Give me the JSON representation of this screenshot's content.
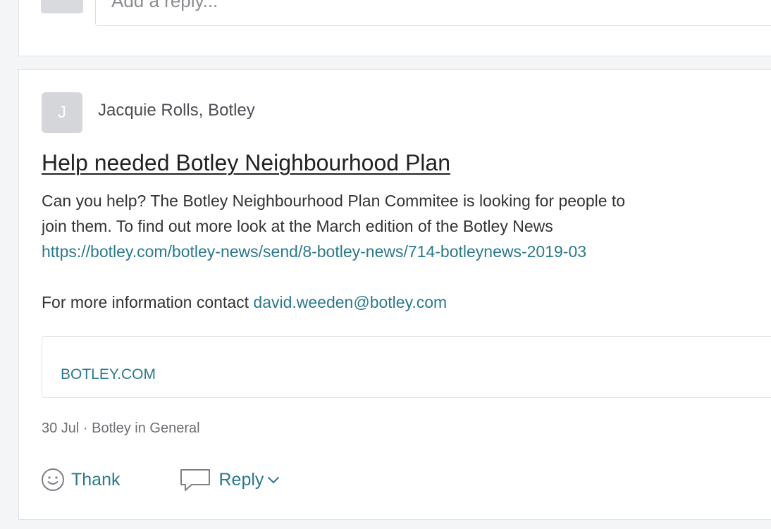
{
  "previous_post": {
    "reply_placeholder": "Add a reply..."
  },
  "post": {
    "avatar_initial": "J",
    "author": "Jacquie Rolls, Botley",
    "title": "Help needed Botley Neighbourhood Plan",
    "body_lines": [
      "Can you help? The Botley Neighbourhood Plan Commitee is looking for people to",
      "join them.  To find out more look at the  March edition of the Botley News"
    ],
    "body_link": "https://botley.com/botley-news/send/8-botley-news/714-botleynews-2019-03",
    "contact_prefix": "For more information contact ",
    "contact_email": "david.weeden@botley.com",
    "link_preview_domain": "BOTLEY.COM",
    "meta": "30 Jul · Botley in General",
    "actions": {
      "thank_label": "Thank",
      "reply_label": "Reply"
    }
  },
  "colors": {
    "link": "#2a7a8c",
    "background": "#f4f5f6",
    "card": "#ffffff"
  },
  "icons": {
    "thank": "smiley-face-icon",
    "reply": "speech-bubble-icon",
    "reply_menu": "chevron-down-icon"
  }
}
